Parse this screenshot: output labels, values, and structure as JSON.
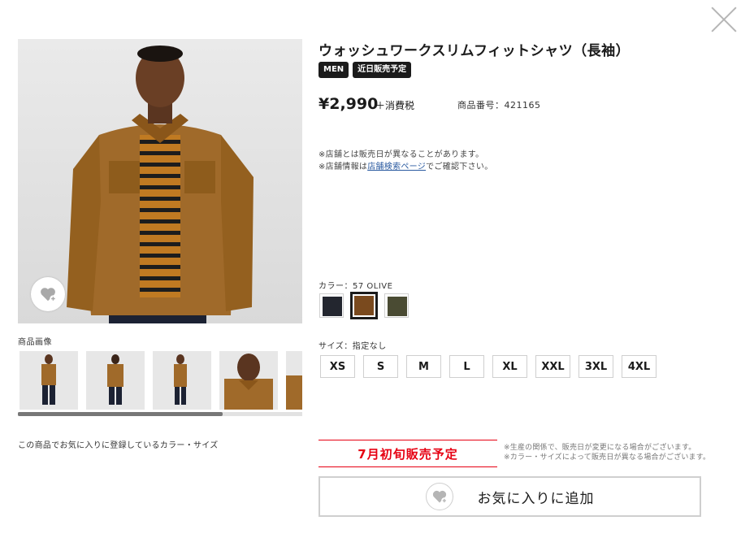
{
  "product": {
    "title": "ウォッシュワークスリムフィットシャツ（長袖）",
    "badges": [
      "MEN",
      "近日販売予定"
    ],
    "price": "¥2,990",
    "tax": "＋消費税",
    "code": "商品番号：421165"
  },
  "notes": {
    "line1": "※店舗とは販売日が異なることがあります。",
    "line2_prefix": "※店舗情報は",
    "line2_link": "店舗検索ページ",
    "line2_suffix": "でご確認下さい。"
  },
  "gallery": {
    "label": "商品画像",
    "favorite_note": "この商品でお気に入りに登録しているカラー・サイズ"
  },
  "color": {
    "label": "カラー：57 OLIVE",
    "swatches": [
      {
        "name": "navy",
        "hex": "#23262f",
        "selected": false
      },
      {
        "name": "brown",
        "hex": "#7a4a1e",
        "selected": true
      },
      {
        "name": "olive",
        "hex": "#4a4b33",
        "selected": false
      }
    ]
  },
  "size": {
    "label": "サイズ：指定なし",
    "options": [
      "XS",
      "S",
      "M",
      "L",
      "XL",
      "XXL",
      "3XL",
      "4XL"
    ]
  },
  "release": {
    "label": "7月初旬販売予定",
    "note1": "※生産の関係で、販売日が変更になる場合がございます。",
    "note2": "※カラー・サイズによって販売日が異なる場合がございます。"
  },
  "actions": {
    "add_favorite": "お気に入りに追加"
  },
  "colors": {
    "accent_red": "#e60012",
    "shirt": "#a06a2a",
    "badge_bg": "#1b1b1b",
    "link": "#2a5aa0"
  }
}
